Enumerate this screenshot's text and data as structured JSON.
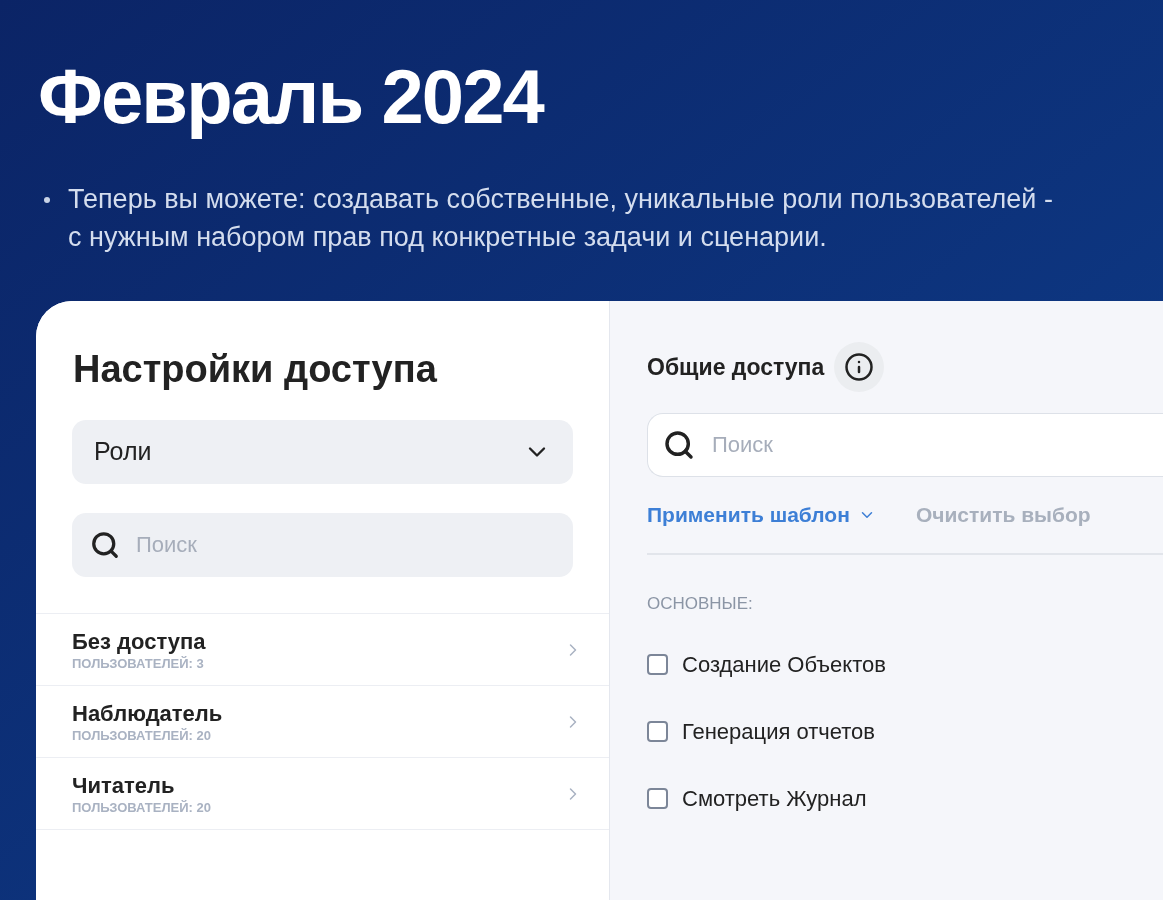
{
  "slide": {
    "title": "Февраль 2024",
    "bullets": [
      "Теперь вы можете: создавать собственные, уникальные роли пользователей - с нужным набором прав под конкретные задачи и сценарии."
    ]
  },
  "left_panel": {
    "title": "Настройки доступа",
    "dropdown": {
      "value": "Роли"
    },
    "search": {
      "placeholder": "Поиск"
    },
    "roles": [
      {
        "name": "Без доступа",
        "count": "ПОЛЬЗОВАТЕЛЕЙ: 3"
      },
      {
        "name": "Наблюдатель",
        "count": "ПОЛЬЗОВАТЕЛЕЙ: 20"
      },
      {
        "name": "Читатель",
        "count": "ПОЛЬЗОВАТЕЛЕЙ: 20"
      }
    ]
  },
  "right_panel": {
    "title": "Общие доступа",
    "search": {
      "placeholder": "Поиск"
    },
    "apply_template": "Применить шаблон",
    "clear_selection": {
      "label": "Очистить выбор",
      "disabled": true
    },
    "section": "ОСНОВНЫЕ:",
    "permissions": [
      {
        "label": "Создание Объектов",
        "checked": false
      },
      {
        "label": "Генерация отчетов",
        "checked": false
      },
      {
        "label": "Смотреть Журнал",
        "checked": false
      }
    ]
  }
}
